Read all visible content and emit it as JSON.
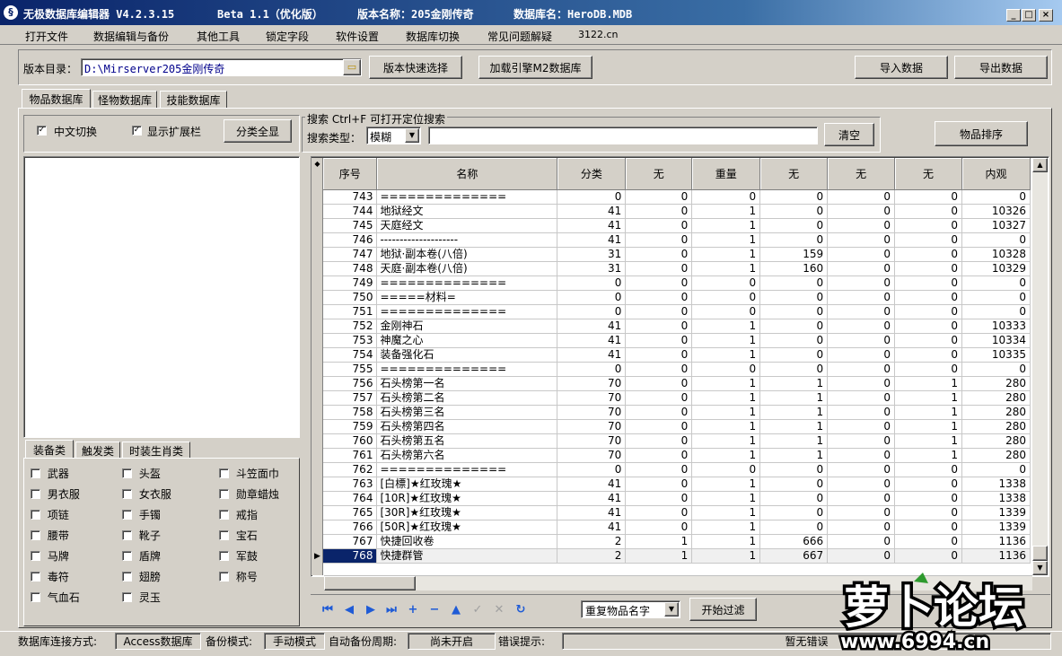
{
  "window": {
    "title": "无极数据库编辑器 V4.2.3.15",
    "beta": "Beta 1.1（优化版）",
    "version": "版本名称：205金刚传奇",
    "dbname": "数据库名：HeroDB.MDB"
  },
  "menu": [
    "打开文件",
    "数据编辑与备份",
    "其他工具",
    "锁定字段",
    "软件设置",
    "数据库切换",
    "常见问题解疑",
    "3122.cn"
  ],
  "toolbar": {
    "dir_label": "版本目录：",
    "dir_value": "D:\\Mirserver205金刚传奇",
    "quick_select": "版本快速选择",
    "load_engine": "加载引擎M2数据库",
    "import": "导入数据",
    "export": "导出数据"
  },
  "tabs": [
    "物品数据库",
    "怪物数据库",
    "技能数据库"
  ],
  "options": {
    "chinese": "中文切换",
    "expand": "显示扩展栏",
    "show_all": "分类全显"
  },
  "search": {
    "group": "搜索  Ctrl+F 可打开定位搜索",
    "type_label": "搜索类型：",
    "type_value": "模糊",
    "clear": "清空",
    "sort": "物品排序"
  },
  "cat_tabs": [
    "装备类",
    "触发类",
    "时装生肖类"
  ],
  "categories": [
    "武器",
    "头盔",
    "斗笠面巾",
    "男衣服",
    "女衣服",
    "勋章蜡烛",
    "项链",
    "手镯",
    "戒指",
    "腰带",
    "靴子",
    "宝石",
    "马牌",
    "盾牌",
    "军鼓",
    "毒符",
    "翅膀",
    "称号",
    "气血石",
    "灵玉"
  ],
  "columns": [
    "序号",
    "名称",
    "分类",
    "无",
    "重量",
    "无",
    "无",
    "无",
    "内观"
  ],
  "rows": [
    [
      "743",
      "==============",
      "0",
      "0",
      "0",
      "0",
      "0",
      "0",
      "0"
    ],
    [
      "744",
      "地狱经文",
      "41",
      "0",
      "1",
      "0",
      "0",
      "0",
      "10326"
    ],
    [
      "745",
      "天庭经文",
      "41",
      "0",
      "1",
      "0",
      "0",
      "0",
      "10327"
    ],
    [
      "746",
      "--------------------",
      "41",
      "0",
      "1",
      "0",
      "0",
      "0",
      "0"
    ],
    [
      "747",
      "地狱·副本卷(八倍)",
      "31",
      "0",
      "1",
      "159",
      "0",
      "0",
      "10328"
    ],
    [
      "748",
      "天庭·副本卷(八倍)",
      "31",
      "0",
      "1",
      "160",
      "0",
      "0",
      "10329"
    ],
    [
      "749",
      "==============",
      "0",
      "0",
      "0",
      "0",
      "0",
      "0",
      "0"
    ],
    [
      "750",
      "=====材料=",
      "0",
      "0",
      "0",
      "0",
      "0",
      "0",
      "0"
    ],
    [
      "751",
      "==============",
      "0",
      "0",
      "0",
      "0",
      "0",
      "0",
      "0"
    ],
    [
      "752",
      "金刚神石",
      "41",
      "0",
      "1",
      "0",
      "0",
      "0",
      "10333"
    ],
    [
      "753",
      "神魔之心",
      "41",
      "0",
      "1",
      "0",
      "0",
      "0",
      "10334"
    ],
    [
      "754",
      "装备强化石",
      "41",
      "0",
      "1",
      "0",
      "0",
      "0",
      "10335"
    ],
    [
      "755",
      "==============",
      "0",
      "0",
      "0",
      "0",
      "0",
      "0",
      "0"
    ],
    [
      "756",
      "石头榜第一名",
      "70",
      "0",
      "1",
      "1",
      "0",
      "1",
      "280"
    ],
    [
      "757",
      "石头榜第二名",
      "70",
      "0",
      "1",
      "1",
      "0",
      "1",
      "280"
    ],
    [
      "758",
      "石头榜第三名",
      "70",
      "0",
      "1",
      "1",
      "0",
      "1",
      "280"
    ],
    [
      "759",
      "石头榜第四名",
      "70",
      "0",
      "1",
      "1",
      "0",
      "1",
      "280"
    ],
    [
      "760",
      "石头榜第五名",
      "70",
      "0",
      "1",
      "1",
      "0",
      "1",
      "280"
    ],
    [
      "761",
      "石头榜第六名",
      "70",
      "0",
      "1",
      "1",
      "0",
      "1",
      "280"
    ],
    [
      "762",
      "==============",
      "0",
      "0",
      "0",
      "0",
      "0",
      "0",
      "0"
    ],
    [
      "763",
      "[白標]★红玫瑰★",
      "41",
      "0",
      "1",
      "0",
      "0",
      "0",
      "1338"
    ],
    [
      "764",
      "[10R]★红玫瑰★",
      "41",
      "0",
      "1",
      "0",
      "0",
      "0",
      "1338"
    ],
    [
      "765",
      "[30R]★红玫瑰★",
      "41",
      "0",
      "1",
      "0",
      "0",
      "0",
      "1339"
    ],
    [
      "766",
      "[50R]★红玫瑰★",
      "41",
      "0",
      "1",
      "0",
      "0",
      "0",
      "1339"
    ],
    [
      "767",
      "快捷回收卷",
      "2",
      "1",
      "1",
      "666",
      "0",
      "0",
      "1136"
    ],
    [
      "768",
      "快捷群管",
      "2",
      "1",
      "1",
      "667",
      "0",
      "0",
      "1136"
    ]
  ],
  "selected_row": "768",
  "filter": {
    "value": "重复物品名字",
    "button": "开始过滤"
  },
  "status": [
    "数据库连接方式:",
    "Access数据库",
    "备份模式:",
    "手动模式",
    "自动备份周期:",
    "尚未开启",
    "错误提示:",
    "暂无错误"
  ],
  "watermark": {
    "brand": "萝卜论坛",
    "url": "www.6994.cn"
  }
}
